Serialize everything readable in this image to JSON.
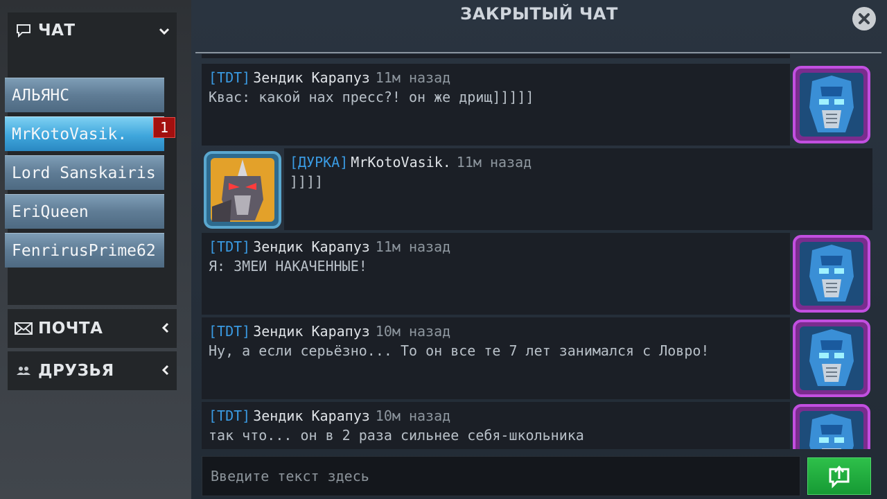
{
  "sidebar": {
    "chat_label": "ЧАТ",
    "mail_label": "ПОЧТА",
    "friends_label": "ДРУЗЬЯ",
    "chats": [
      {
        "label": "АЛЬЯНС",
        "active": false
      },
      {
        "label": "MrKotoVasik.",
        "active": true,
        "badge": "1"
      },
      {
        "label": "Lord Sanskairis",
        "active": false
      },
      {
        "label": "EriQueen",
        "active": false
      },
      {
        "label": "FenrirusPrime62",
        "active": false
      }
    ]
  },
  "header": {
    "title": "ЗАКРЫТЫЙ ЧАТ"
  },
  "messages": [
    {
      "tag": "[TDT]",
      "author": "Зендик Карапуз",
      "time": "11м назад",
      "text": "Квас: какой нах пресс?! он же дрищ]]]]]",
      "avatar": "blue-robot-avatar",
      "side": "right"
    },
    {
      "tag": "[ДУРКА]",
      "author": "MrKotoVasik.",
      "time": "11м назад",
      "text": "]]]]",
      "avatar": "orange-robot-avatar",
      "side": "left"
    },
    {
      "tag": "[TDT]",
      "author": "Зендик Карапуз",
      "time": "11м назад",
      "text": "Я: ЗМЕИ НАКАЧЕННЫЕ!",
      "avatar": "blue-robot-avatar",
      "side": "right"
    },
    {
      "tag": "[TDT]",
      "author": "Зендик Карапуз",
      "time": "10м назад",
      "text": "Ну, а если серьёзно... То он все те 7 лет занимался с Ловро!",
      "avatar": "blue-robot-avatar",
      "side": "right"
    },
    {
      "tag": "[TDT]",
      "author": "Зендик Карапуз",
      "time": "10м назад",
      "text": "так что... он в 2 раза сильнее себя-школьника",
      "avatar": "blue-robot-avatar",
      "side": "right"
    }
  ],
  "composer": {
    "placeholder": "Введите текст здесь"
  },
  "colors": {
    "accent_blue": "#3a9be3",
    "send_green": "#1fae3e",
    "badge_red": "#a3100f",
    "avatar_frame_purple": "#c24fe0"
  }
}
